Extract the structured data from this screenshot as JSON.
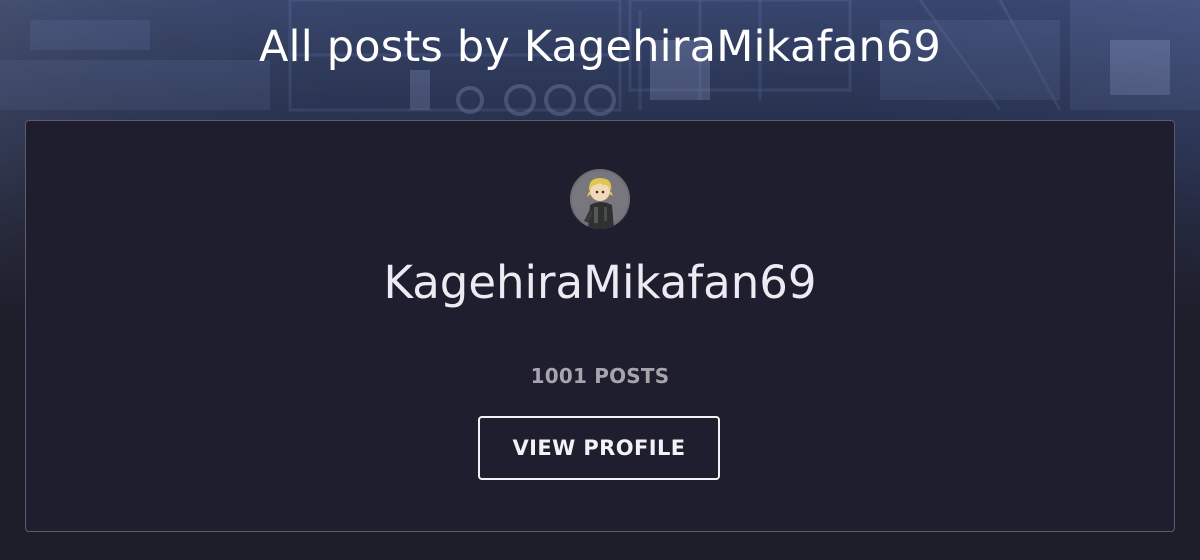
{
  "header": {
    "title": "All posts by KagehiraMikafan69"
  },
  "author": {
    "name": "KagehiraMikafan69",
    "post_count": "1001 POSTS",
    "view_profile_label": "VIEW PROFILE",
    "avatar_icon": "user-avatar-icon"
  },
  "colors": {
    "background": "#1d1d29",
    "card": "#1f1e2e",
    "text": "#ffffff",
    "muted": "#a6a4ad"
  }
}
